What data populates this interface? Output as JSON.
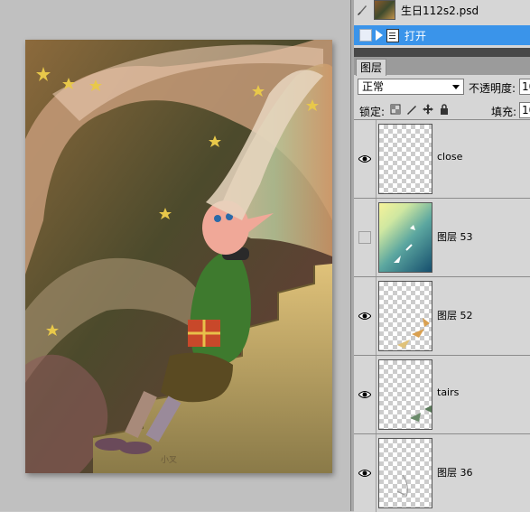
{
  "history": {
    "file_name": "生日112s2.psd",
    "open_step": "打开"
  },
  "layers_panel": {
    "tab_label": "图层",
    "blend_mode": "正常",
    "opacity_label": "不透明度:",
    "opacity_value": "10",
    "lock_label": "锁定:",
    "fill_label": "填充:",
    "fill_value": "10",
    "layers": [
      {
        "name": "close",
        "visible": true,
        "thumb": "transparent"
      },
      {
        "name": "图层 53",
        "visible": false,
        "thumb": "gradient"
      },
      {
        "name": "图层 52",
        "visible": true,
        "thumb": "transparent"
      },
      {
        "name": "tairs",
        "visible": true,
        "thumb": "transparent"
      },
      {
        "name": "图层 36",
        "visible": true,
        "thumb": "transparent"
      }
    ]
  },
  "artwork": {
    "signature": "小叉"
  },
  "colors": {
    "selection_blue": "#3a94ea",
    "panel_bg": "#d6d6d6",
    "canvas_bg": "#c0c0c0"
  },
  "icons": [
    "brush-icon",
    "play-icon",
    "document-icon",
    "eye-icon",
    "lock-transparency-icon",
    "lock-paint-icon",
    "lock-move-icon",
    "lock-all-icon",
    "dropdown-arrow-icon"
  ]
}
